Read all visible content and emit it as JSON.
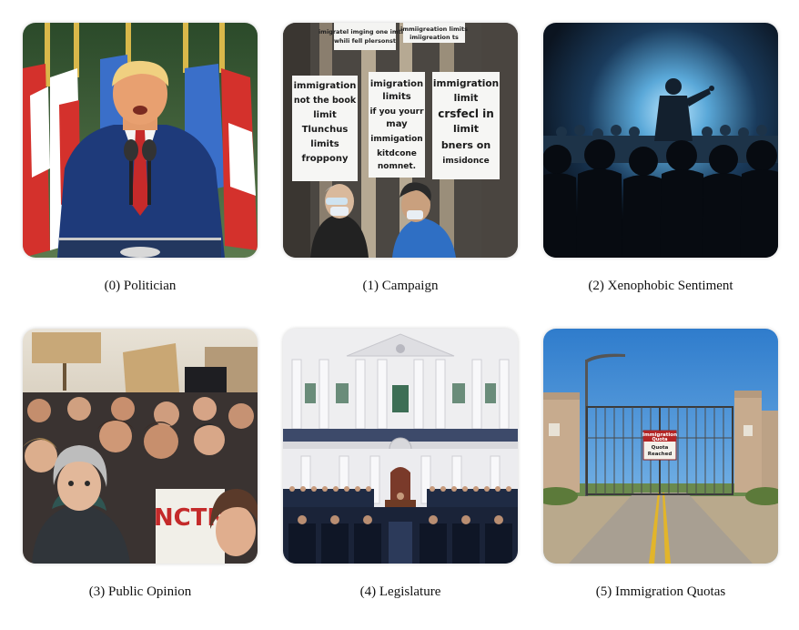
{
  "panels": [
    {
      "index": "(0)",
      "label": "(0) Politician"
    },
    {
      "index": "(1)",
      "label": "(1) Campaign"
    },
    {
      "index": "(2)",
      "label": "(2) Xenophobic Sentiment"
    },
    {
      "index": "(3)",
      "label": "(3) Public Opinion"
    },
    {
      "index": "(4)",
      "label": "(4) Legislature"
    },
    {
      "index": "(5)",
      "label": "(5) Immigration Quotas"
    }
  ],
  "signs": {
    "campaign_top_left": [
      "imigratel imging one imtion",
      "whili fell plersonst"
    ],
    "campaign_top_right": [
      "immiigreation limits",
      "imiigreation ts"
    ],
    "campaign_sign_1": [
      "immigration",
      "not the book",
      "limit",
      "Tlunchus",
      "limits",
      "froppony"
    ],
    "campaign_sign_2": [
      "imigration",
      "limits",
      "if you yourr",
      "may",
      "immigation",
      "kitdcone",
      "nomnet."
    ],
    "campaign_sign_3": [
      "immigration",
      "limit",
      "crsfecl in",
      "limit",
      "bners on",
      "imsidonce"
    ],
    "opinion_sign": "NCTN",
    "quota_sign": [
      "Immigration",
      "Quota",
      "Quota",
      "Reached"
    ]
  },
  "colors": {
    "caption_text": "#111111",
    "sky_blue": "#3f8fd8",
    "suit_navy": "#1e3a7a",
    "flag_red": "#d4312c",
    "spotlight": "#8fd0f0",
    "capitol_white": "#eeeef0"
  }
}
